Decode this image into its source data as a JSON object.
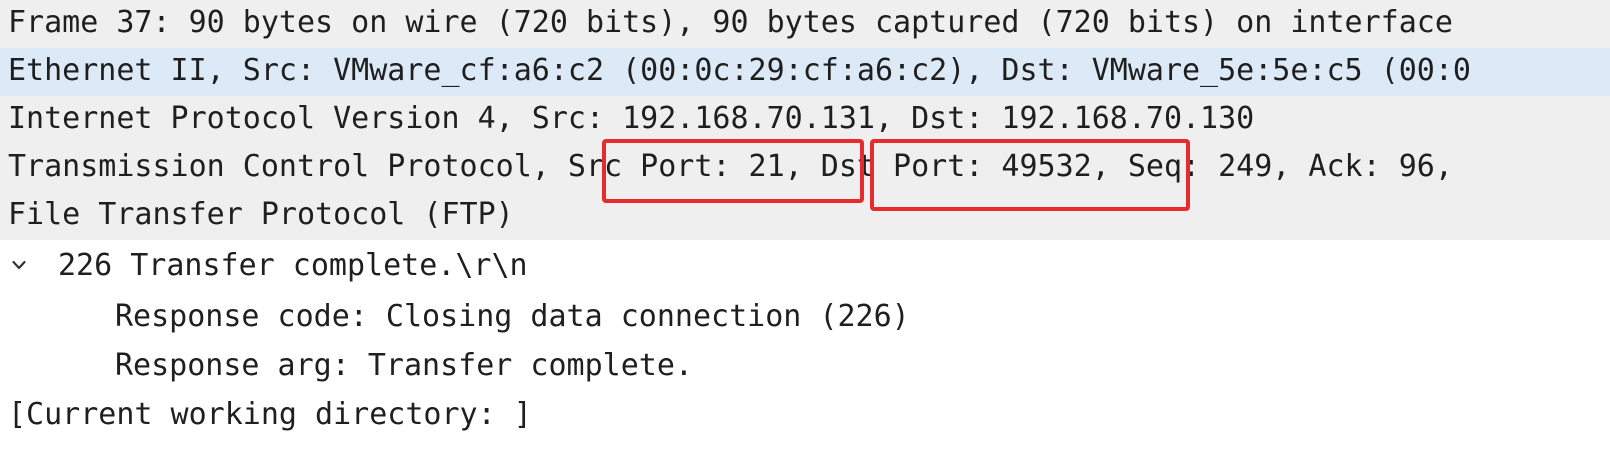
{
  "packet_details": {
    "rows": [
      "Frame 37: 90 bytes on wire (720 bits), 90 bytes captured (720 bits) on interface",
      "Ethernet II, Src: VMware_cf:a6:c2 (00:0c:29:cf:a6:c2), Dst: VMware_5e:5e:c5 (00:0",
      "Internet Protocol Version 4, Src: 192.168.70.131, Dst: 192.168.70.130",
      "Transmission Control Protocol, Src Port: 21, Dst Port: 49532, Seq: 249, Ack: 96,",
      "File Transfer Protocol (FTP)",
      "226 Transfer complete.\\r\\n",
      "Response code: Closing data connection (226)",
      "Response arg: Transfer complete.",
      "[Current working directory: ]"
    ]
  },
  "highlights": {
    "color": "#e52b2b"
  },
  "colors": {
    "row_gray": "#efefef",
    "row_selected": "#dce9f6",
    "row_white": "#ffffff",
    "text": "#1f1f1f"
  },
  "icons": {
    "expand": "chevron-down-icon"
  }
}
